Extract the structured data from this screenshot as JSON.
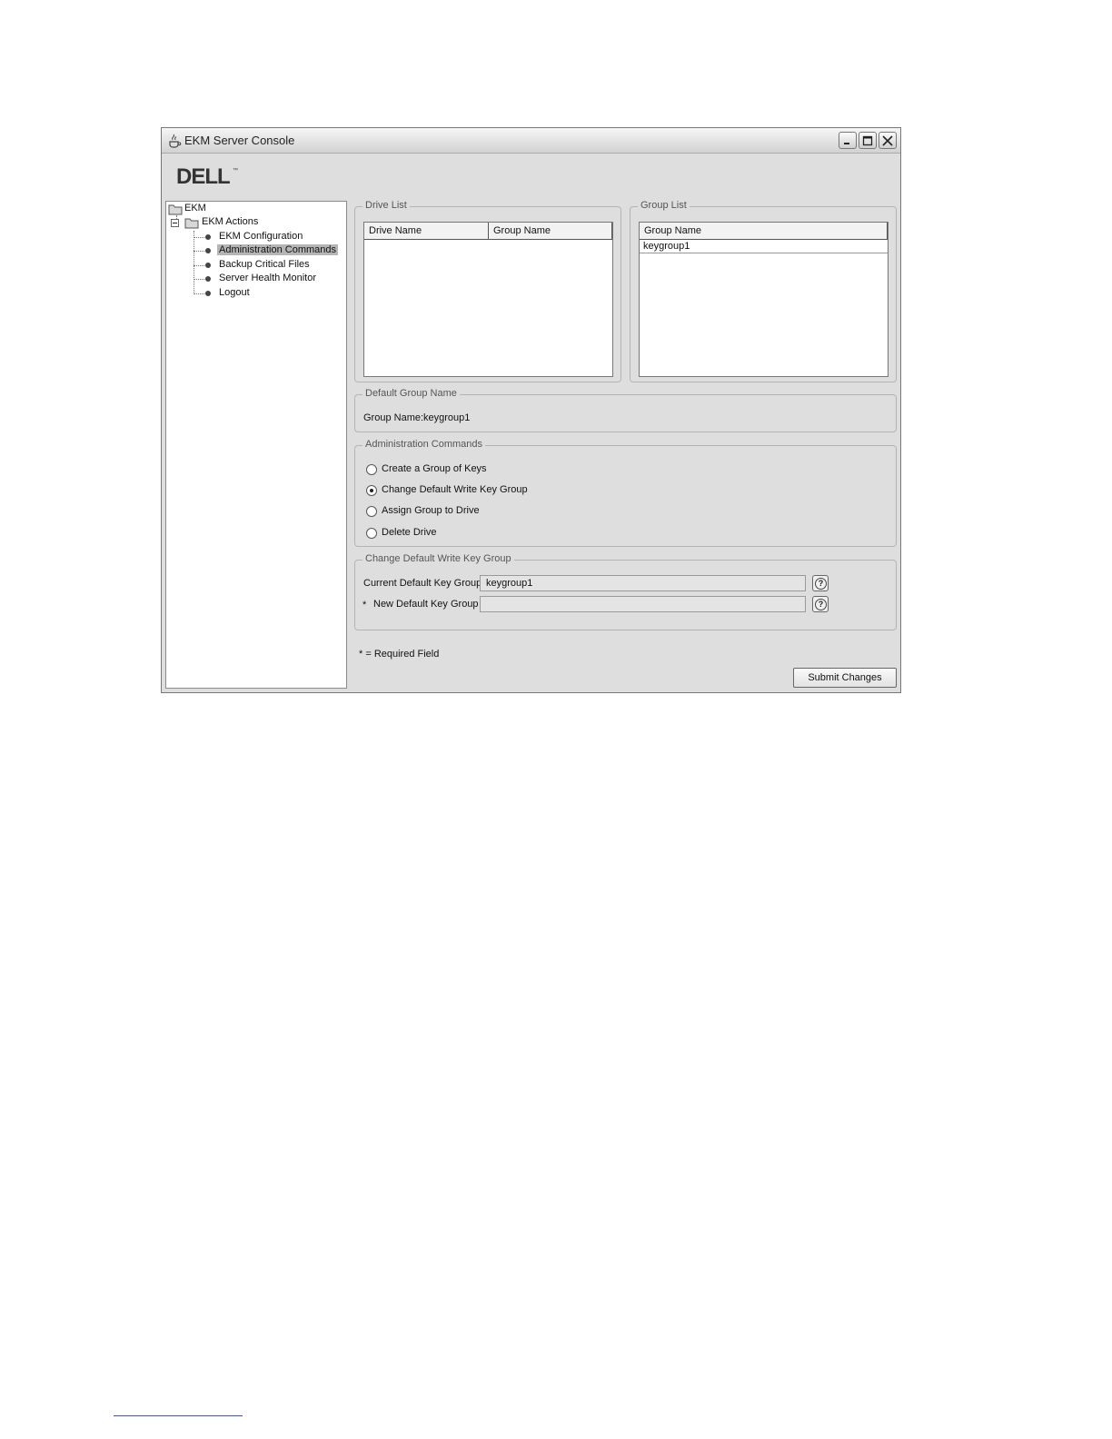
{
  "window": {
    "title": "EKM Server Console",
    "logo_text": "DELL"
  },
  "tree": {
    "root": "EKM",
    "group": "EKM Actions",
    "items": [
      {
        "label": "EKM Configuration",
        "selected": false
      },
      {
        "label": "Administration Commands",
        "selected": true
      },
      {
        "label": "Backup Critical Files",
        "selected": false
      },
      {
        "label": "Server Health Monitor",
        "selected": false
      },
      {
        "label": "Logout",
        "selected": false
      }
    ]
  },
  "drive_list": {
    "legend": "Drive List",
    "columns": [
      "Drive Name",
      "Group Name"
    ],
    "rows": []
  },
  "group_list": {
    "legend": "Group List",
    "columns": [
      "Group Name"
    ],
    "rows": [
      "keygroup1"
    ]
  },
  "default_group": {
    "legend": "Default Group Name",
    "label": "Group Name:",
    "value": "keygroup1"
  },
  "admin_commands": {
    "legend": "Administration Commands",
    "options": [
      {
        "label": "Create a Group of Keys",
        "selected": false
      },
      {
        "label": "Change Default Write Key Group",
        "selected": true
      },
      {
        "label": "Assign Group to Drive",
        "selected": false
      },
      {
        "label": "Delete Drive",
        "selected": false
      }
    ]
  },
  "change_default": {
    "legend": "Change Default Write Key Group",
    "current_label": "Current Default Key Group:",
    "current_value": "keygroup1",
    "new_label": "New Default Key Group",
    "new_required_mark": "*",
    "new_value": ""
  },
  "footer": {
    "required_note": "* = Required Field",
    "submit_label": "Submit Changes"
  }
}
